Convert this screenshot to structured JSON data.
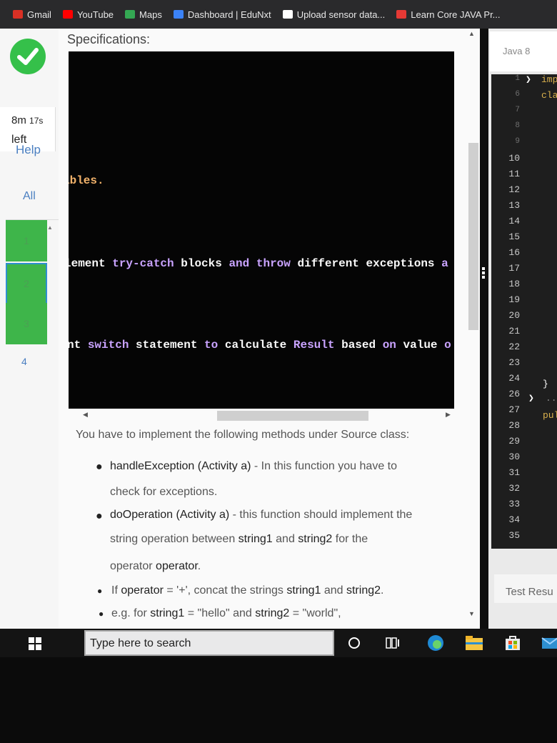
{
  "bookmarks": [
    {
      "label": "Gmail",
      "icon": "gmail-icon",
      "color": "#d93025"
    },
    {
      "label": "YouTube",
      "icon": "youtube-icon",
      "color": "#ff0000"
    },
    {
      "label": "Maps",
      "icon": "maps-icon",
      "color": "#34a853"
    },
    {
      "label": "Dashboard | EduNxt",
      "icon": "edunxt-icon",
      "color": "#3b82f6"
    },
    {
      "label": "Upload sensor data...",
      "icon": "sensor-icon",
      "color": "#ffffff"
    },
    {
      "label": "Learn Core JAVA Pr...",
      "icon": "java-course-icon",
      "color": "#e53935"
    }
  ],
  "sidebar": {
    "timer_value": "8m",
    "timer_seconds": "17s",
    "timer_suffix": "left",
    "help_label": "Help",
    "all_label": "All",
    "questions": [
      "1",
      "2",
      "3",
      "4"
    ]
  },
  "main": {
    "title": "Specifications:",
    "code_lines": {
      "line1": {
        "text": "ables."
      },
      "line2": [
        {
          "t": "lement ",
          "c": "w"
        },
        {
          "t": "try-catch",
          "c": "k"
        },
        {
          "t": " blocks ",
          "c": "w"
        },
        {
          "t": "and",
          "c": "k"
        },
        {
          "t": " ",
          "c": "w"
        },
        {
          "t": "throw",
          "c": "k"
        },
        {
          "t": " different exceptions ",
          "c": "w"
        },
        {
          "t": "a",
          "c": "k"
        }
      ],
      "line3": [
        {
          "t": "nt ",
          "c": "w"
        },
        {
          "t": "switch",
          "c": "k"
        },
        {
          "t": " statement ",
          "c": "w"
        },
        {
          "t": "to",
          "c": "k"
        },
        {
          "t": " calculate ",
          "c": "w"
        },
        {
          "t": "Result",
          "c": "k"
        },
        {
          "t": " based ",
          "c": "w"
        },
        {
          "t": "on",
          "c": "k"
        },
        {
          "t": " value ",
          "c": "w"
        },
        {
          "t": "o",
          "c": "k"
        }
      ]
    },
    "intro": "You have to implement the following methods under Source class:",
    "items": [
      {
        "pre": "handleException (Activity a)",
        "post": " - In this function you have to"
      },
      {
        "cont": "check for exceptions."
      },
      {
        "pre": "doOperation (Activity a)",
        "post": " - this function should implement the"
      },
      {
        "cont_pre": "string operation between ",
        "b1": "string1",
        "mid": " and ",
        "b2": "string2",
        "cont_post": " for the"
      },
      {
        "cont2_pre": "operator ",
        "b3": "operator",
        "cont2_post": "."
      },
      {
        "sub_pre": "If ",
        "sb1": "operator",
        "sub_mid": " = '+', concat the strings ",
        "sb2": "string1",
        "sub_and": " and ",
        "sb3": "string2",
        "sub_post": "."
      },
      {
        "eg": "e.g. for ",
        "eb1": "string1",
        "eg2": " = \"hello\" and ",
        "eb2": "string2",
        "eg3": " = \"world\","
      }
    ]
  },
  "editor": {
    "language": "Java 8",
    "line_numbers": [
      "1",
      "6",
      "7",
      "8",
      "9",
      "10",
      "11",
      "12",
      "13",
      "14",
      "15",
      "16",
      "17",
      "18",
      "19",
      "20",
      "21",
      "22",
      "23",
      "24",
      "26",
      "27",
      "28",
      "29",
      "30",
      "31",
      "32",
      "33",
      "34",
      "35"
    ],
    "code_frag_1": "imp",
    "code_frag_2": "cla",
    "code_frag_27": "pul",
    "code_frag_23": "}",
    "code_frag_24": "...",
    "test_results": "Test Resu"
  },
  "taskbar": {
    "search_placeholder": "Type here to search"
  }
}
